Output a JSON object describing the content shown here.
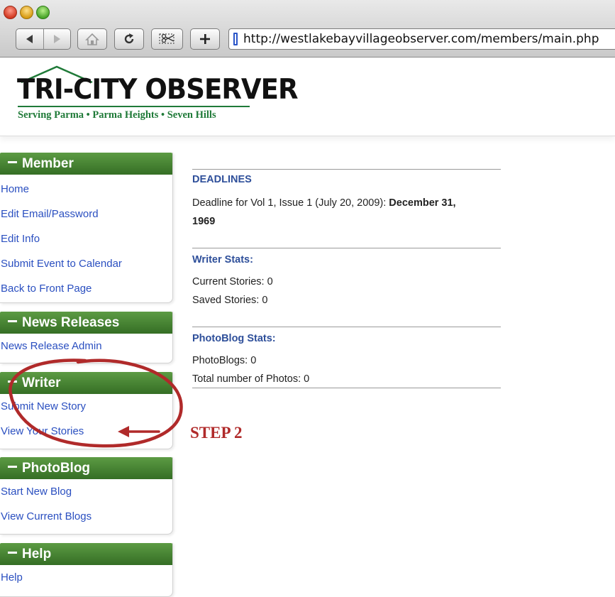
{
  "browser": {
    "url": "http://westlakebayvillageobserver.com/members/main.php",
    "buttons": [
      "back-icon",
      "forward-icon",
      "home-icon",
      "reload-icon",
      "snip-icon",
      "add-bookmark-icon"
    ]
  },
  "site": {
    "logo_title": "TRI-CITY OBSERVER",
    "tagline": "Serving Parma • Parma Heights • Seven Hills",
    "colors": {
      "accent_green": "#1f7a38",
      "link_blue": "#2a4fc0",
      "heading_blue": "#2e4f9a",
      "annotation_red": "#b02a2a"
    }
  },
  "sidebar": {
    "member": {
      "title": "Member",
      "links": [
        "Home",
        "Edit Email/Password",
        "Edit Info",
        "Submit Event to Calendar",
        "Back to Front Page"
      ]
    },
    "news_releases": {
      "title": "News Releases",
      "links": [
        "News Release Admin"
      ]
    },
    "writer": {
      "title": "Writer",
      "links": [
        "Submit New Story",
        "View Your Stories"
      ]
    },
    "photoblog": {
      "title": "PhotoBlog",
      "links": [
        "Start New Blog",
        "View Current Blogs"
      ]
    },
    "help": {
      "title": "Help",
      "links": [
        "Help"
      ]
    }
  },
  "main": {
    "deadlines": {
      "title": "DEADLINES",
      "line_prefix": "Deadline for Vol 1, Issue 1 (July 20, 2009): ",
      "line_bold_1": "December 31,",
      "line_bold_2": "1969"
    },
    "writer_stats": {
      "title": "Writer Stats:",
      "current": "Current Stories: 0",
      "saved": "Saved Stories: 0"
    },
    "photoblog_stats": {
      "title": "PhotoBlog Stats:",
      "blogs": "PhotoBlogs: 0",
      "photos": "Total number of Photos: 0"
    }
  },
  "annotation": {
    "label": "STEP 2"
  }
}
